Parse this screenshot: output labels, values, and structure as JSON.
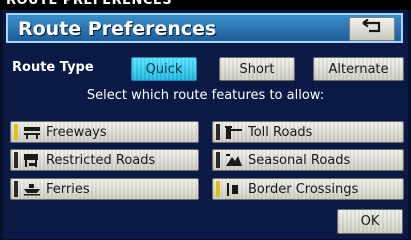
{
  "caption": "ROUTE PREFERENCES",
  "header": {
    "title": "Route Preferences",
    "back_icon": "return-arrow-icon"
  },
  "route_type": {
    "label": "Route Type",
    "options": [
      {
        "label": "Quick",
        "selected": true
      },
      {
        "label": "Short",
        "selected": false
      },
      {
        "label": "Alternate",
        "selected": false
      }
    ]
  },
  "instruction": "Select which route features to allow:",
  "features": [
    {
      "label": "Freeways",
      "icon": "freeway-icon",
      "allowed": true
    },
    {
      "label": "Toll Roads",
      "icon": "toll-booth-icon",
      "allowed": false
    },
    {
      "label": "Restricted Roads",
      "icon": "restricted-road-icon",
      "allowed": false
    },
    {
      "label": "Seasonal Roads",
      "icon": "seasonal-road-icon",
      "allowed": false
    },
    {
      "label": "Ferries",
      "icon": "ferry-icon",
      "allowed": false
    },
    {
      "label": "Border Crossings",
      "icon": "border-crossing-icon",
      "allowed": true
    }
  ],
  "ok_label": "OK",
  "colors": {
    "selected": "#1fb7e0",
    "indicator_on": "#d9c21a",
    "header": "#1e5d99"
  }
}
